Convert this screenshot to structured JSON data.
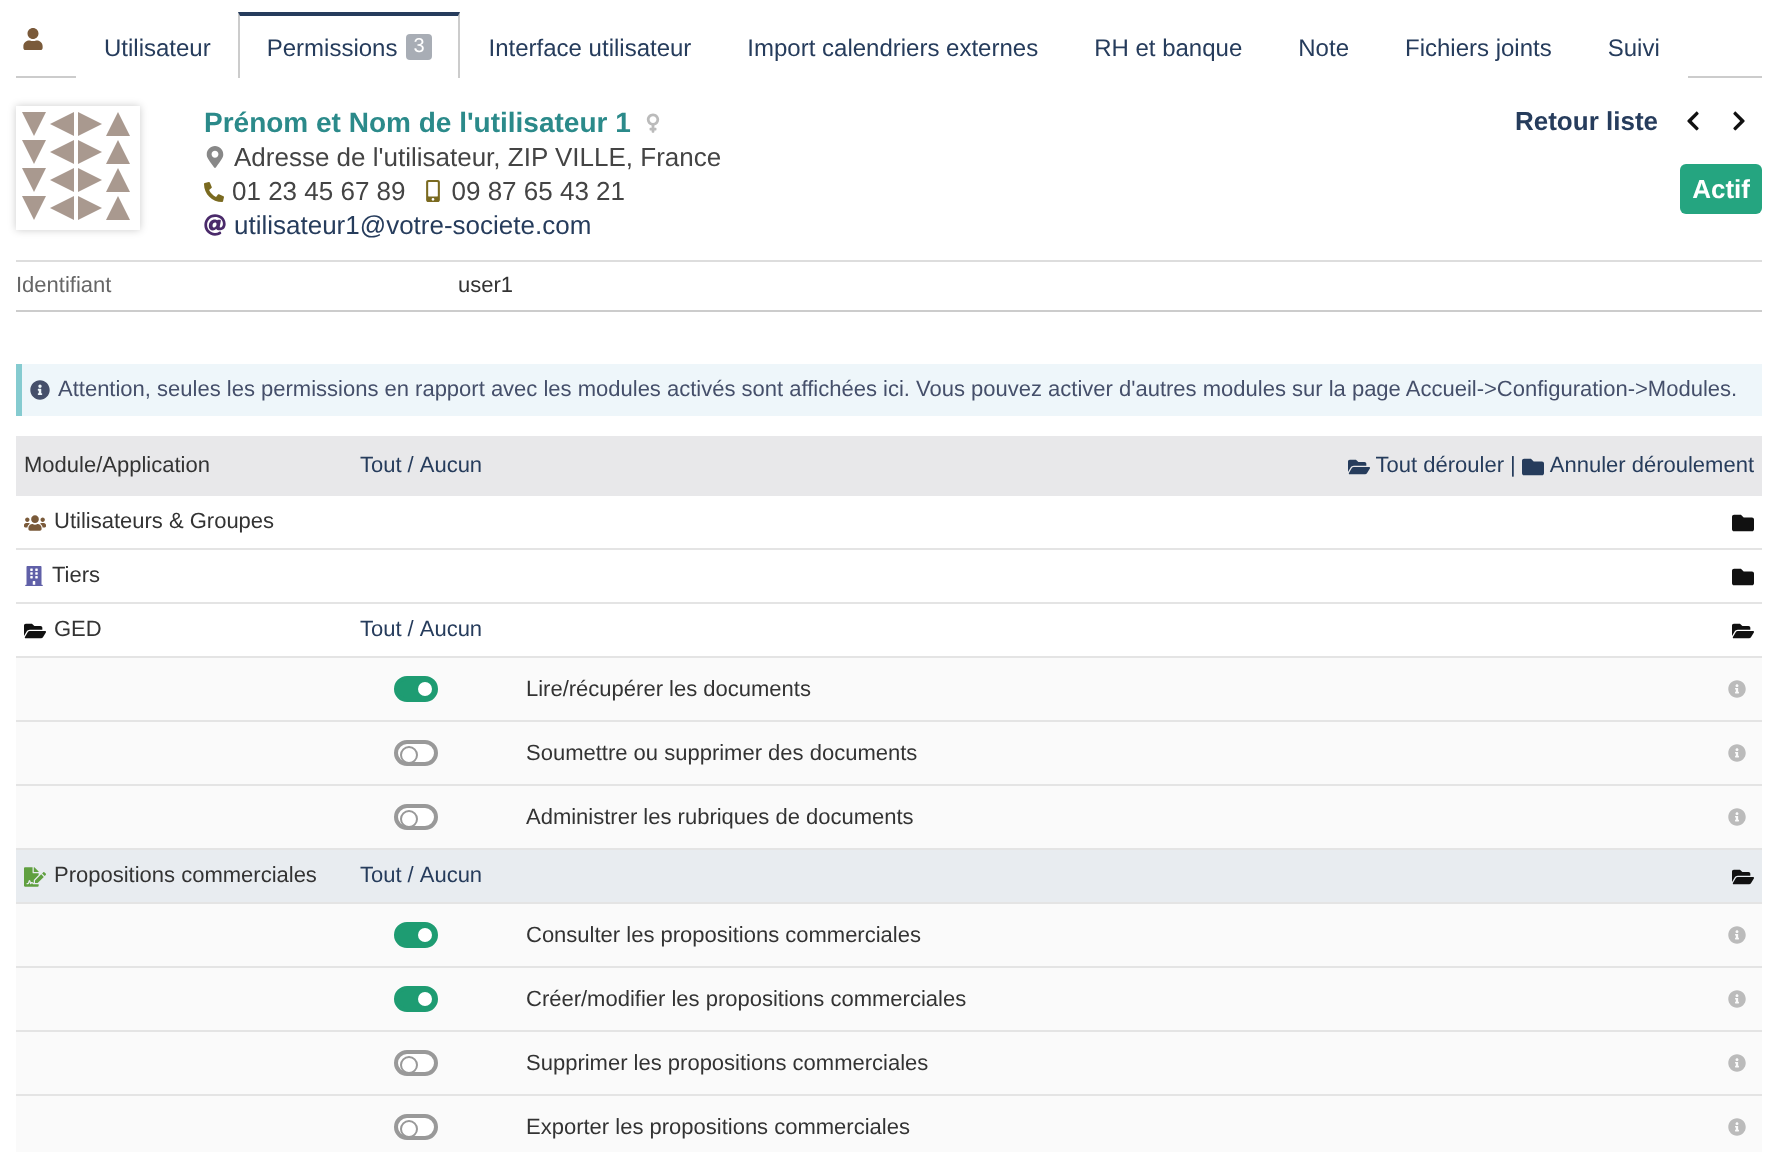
{
  "tabs": [
    {
      "label": "Utilisateur",
      "selected": false
    },
    {
      "label": "Permissions",
      "badge": "3",
      "selected": true
    },
    {
      "label": "Interface utilisateur",
      "selected": false
    },
    {
      "label": "Import calendriers externes",
      "selected": false
    },
    {
      "label": "RH et banque",
      "selected": false
    },
    {
      "label": "Note",
      "selected": false
    },
    {
      "label": "Fichiers joints",
      "selected": false
    },
    {
      "label": "Suivi",
      "selected": false
    }
  ],
  "user": {
    "name": "Prénom et Nom de l'utilisateur 1",
    "address": "Adresse de l'utilisateur, ZIP VILLE, France",
    "phone": "01 23 45 67 89",
    "mobile": "09 87 65 43 21",
    "email": "utilisateur1@votre-societe.com",
    "back_link": "Retour liste",
    "status": "Actif"
  },
  "fields": [
    {
      "label": "Identifiant",
      "value": "user1"
    }
  ],
  "notice": "Attention, seules les permissions en rapport avec les modules activés sont affichées ici. Vous pouvez activer d'autres modules sur la page Accueil->Configuration->Modules.",
  "table": {
    "column_1": "Module/Application",
    "all": "Tout",
    "separator": "/",
    "none": "Aucun",
    "expand_all": "Tout dérouler",
    "divider": "|",
    "collapse_all": "Annuler déroulement",
    "modules": [
      {
        "name": "Utilisateurs & Groupes",
        "kind": "users",
        "expanded": false,
        "highlighted": false
      },
      {
        "name": "Tiers",
        "kind": "building",
        "expanded": false,
        "highlighted": false
      },
      {
        "name": "GED",
        "kind": "folder",
        "expanded": true,
        "highlighted": false,
        "all": "Tout",
        "separator": "/",
        "none": "Aucun",
        "permissions": [
          {
            "label": "Lire/récupérer les documents",
            "on": true
          },
          {
            "label": "Soumettre ou supprimer des documents",
            "on": false
          },
          {
            "label": "Administrer les rubriques de documents",
            "on": false
          }
        ]
      },
      {
        "name": "Propositions commerciales",
        "kind": "proposal",
        "expanded": true,
        "highlighted": true,
        "all": "Tout",
        "separator": "/",
        "none": "Aucun",
        "permissions": [
          {
            "label": "Consulter les propositions commerciales",
            "on": true
          },
          {
            "label": "Créer/modifier les propositions commerciales",
            "on": true
          },
          {
            "label": "Supprimer les propositions commerciales",
            "on": false
          },
          {
            "label": "Exporter les propositions commerciales",
            "on": false
          }
        ]
      }
    ]
  }
}
